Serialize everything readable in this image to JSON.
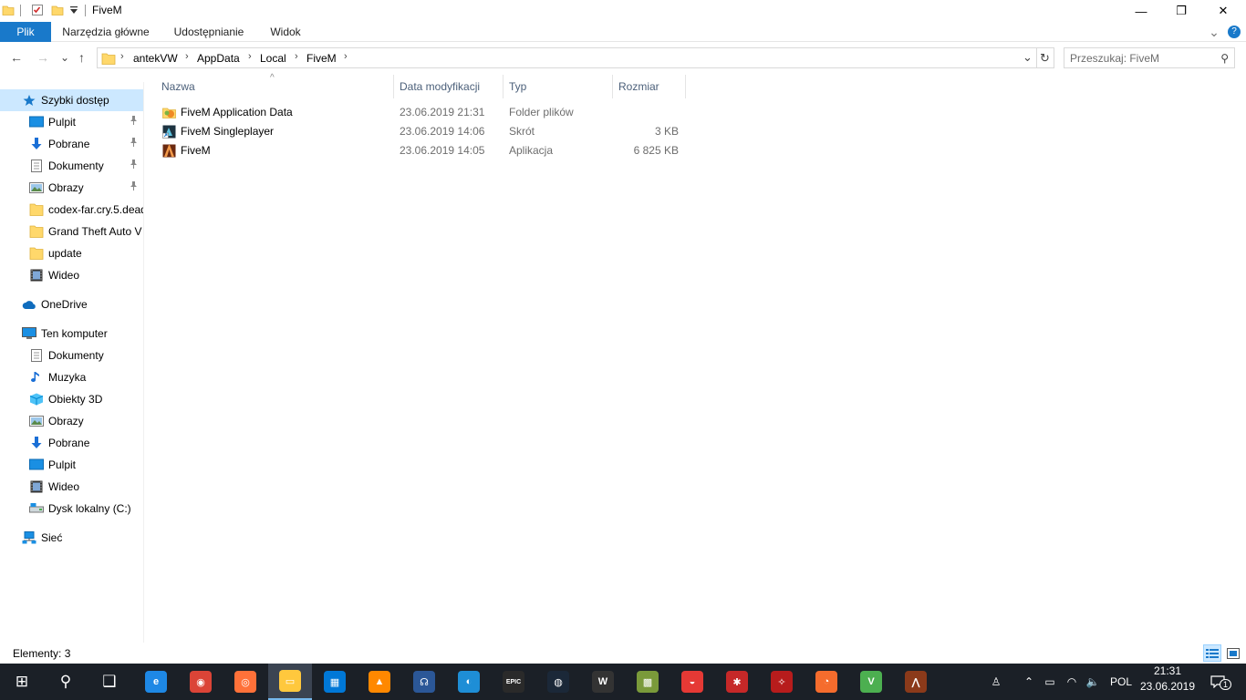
{
  "window": {
    "title": "FiveM",
    "quick_access_icons": [
      "folder-icon",
      "properties-checklist-icon",
      "new-folder-icon",
      "dropdown-arrow-icon"
    ],
    "controls": {
      "minimize": "—",
      "maximize": "❐",
      "close": "✕"
    }
  },
  "ribbon": {
    "tabs": [
      {
        "label": "Plik"
      },
      {
        "label": "Narzędzia główne"
      },
      {
        "label": "Udostępnianie"
      },
      {
        "label": "Widok"
      }
    ],
    "expand_glyph": "⌄",
    "help_glyph": "?"
  },
  "navigation": {
    "back": "←",
    "forward": "→",
    "recent": "⌄",
    "up": "↑",
    "breadcrumb": [
      "antekVW",
      "AppData",
      "Local",
      "FiveM"
    ],
    "separator": "›",
    "dropdown": "⌄",
    "refresh": "↻",
    "search_placeholder": "Przeszukaj: FiveM",
    "search_glyph": "⚲"
  },
  "sidebar": {
    "items": [
      {
        "label": "Szybki dostęp",
        "icon": "star-icon",
        "pinned": false,
        "selected": true,
        "indent": 1
      },
      {
        "label": "Pulpit",
        "icon": "desktop-icon",
        "pinned": true,
        "indent": 2
      },
      {
        "label": "Pobrane",
        "icon": "download-arrow-icon",
        "pinned": true,
        "indent": 2
      },
      {
        "label": "Dokumenty",
        "icon": "document-icon",
        "pinned": true,
        "indent": 2
      },
      {
        "label": "Obrazy",
        "icon": "pictures-icon",
        "pinned": true,
        "indent": 2
      },
      {
        "label": "codex-far.cry.5.dead",
        "icon": "folder-icon",
        "pinned": false,
        "indent": 2
      },
      {
        "label": "Grand Theft Auto V",
        "icon": "folder-icon",
        "pinned": false,
        "indent": 2
      },
      {
        "label": "update",
        "icon": "folder-icon",
        "pinned": false,
        "indent": 2
      },
      {
        "label": "Wideo",
        "icon": "video-icon",
        "pinned": false,
        "indent": 2
      },
      {
        "label": "OneDrive",
        "icon": "cloud-icon",
        "pinned": false,
        "indent": 1
      },
      {
        "label": "Ten komputer",
        "icon": "computer-icon",
        "pinned": false,
        "indent": 1
      },
      {
        "label": "Dokumenty",
        "icon": "document-icon",
        "pinned": false,
        "indent": 2
      },
      {
        "label": "Muzyka",
        "icon": "music-note-icon",
        "pinned": false,
        "indent": 2
      },
      {
        "label": "Obiekty 3D",
        "icon": "cube-3d-icon",
        "pinned": false,
        "indent": 2
      },
      {
        "label": "Obrazy",
        "icon": "pictures-icon",
        "pinned": false,
        "indent": 2
      },
      {
        "label": "Pobrane",
        "icon": "download-arrow-icon",
        "pinned": false,
        "indent": 2
      },
      {
        "label": "Pulpit",
        "icon": "desktop-icon",
        "pinned": false,
        "indent": 2
      },
      {
        "label": "Wideo",
        "icon": "video-icon",
        "pinned": false,
        "indent": 2
      },
      {
        "label": "Dysk lokalny (C:)",
        "icon": "drive-icon",
        "pinned": false,
        "indent": 2
      },
      {
        "label": "Sieć",
        "icon": "network-icon",
        "pinned": false,
        "indent": 1
      }
    ],
    "pin_glyph": "📌"
  },
  "filelist": {
    "columns": {
      "name": "Nazwa",
      "date": "Data modyfikacji",
      "type": "Typ",
      "size": "Rozmiar"
    },
    "sort_glyph": "^",
    "rows": [
      {
        "name": "FiveM Application Data",
        "date": "23.06.2019 21:31",
        "type": "Folder plików",
        "size": "",
        "icon": "fivem-folder-icon"
      },
      {
        "name": "FiveM Singleplayer",
        "date": "23.06.2019 14:06",
        "type": "Skrót",
        "size": "3 KB",
        "icon": "shortcut-icon"
      },
      {
        "name": "FiveM",
        "date": "23.06.2019 14:05",
        "type": "Aplikacja",
        "size": "6 825 KB",
        "icon": "fivem-app-icon"
      }
    ]
  },
  "statusbar": {
    "count": "Elementy: 3"
  },
  "taskbar": {
    "apps": [
      {
        "name": "start-windows-icon",
        "glyph": "⊞",
        "color": "#1b2027"
      },
      {
        "name": "search-icon",
        "glyph": "⚲",
        "color": "#1b2027"
      },
      {
        "name": "task-view-icon",
        "glyph": "❑",
        "color": "#1b2027"
      },
      {
        "name": "edge-icon",
        "glyph": "e",
        "color": "#1e88e5"
      },
      {
        "name": "chrome-icon",
        "glyph": "◉",
        "color": "#db4437"
      },
      {
        "name": "firefox-icon",
        "glyph": "◎",
        "color": "#ff7139"
      },
      {
        "name": "file-explorer-icon",
        "glyph": "▭",
        "color": "#ffc83d"
      },
      {
        "name": "store-icon",
        "glyph": "▦",
        "color": "#0078d7"
      },
      {
        "name": "vlc-icon",
        "glyph": "▲",
        "color": "#ff8800"
      },
      {
        "name": "headset-chat-icon",
        "glyph": "☊",
        "color": "#2b5797"
      },
      {
        "name": "uplay-icon",
        "glyph": "◐",
        "color": "#1e8ed6"
      },
      {
        "name": "epic-games-icon",
        "glyph": "EPIC",
        "color": "#2a2a2a"
      },
      {
        "name": "steam-icon",
        "glyph": "◍",
        "color": "#1b2838"
      },
      {
        "name": "world-of-tanks-icon",
        "glyph": "W",
        "color": "#333333"
      },
      {
        "name": "minecraft-icon",
        "glyph": "▩",
        "color": "#7a9a3a"
      },
      {
        "name": "pokeball-icon",
        "glyph": "◒",
        "color": "#e53935"
      },
      {
        "name": "mod-tool-icon",
        "glyph": "✱",
        "color": "#c62828"
      },
      {
        "name": "compass-app-icon",
        "glyph": "✧",
        "color": "#b71c1c"
      },
      {
        "name": "origin-icon",
        "glyph": "◔",
        "color": "#f56c2d"
      },
      {
        "name": "gta-v-icon",
        "glyph": "V",
        "color": "#4caf50"
      },
      {
        "name": "fivem-taskbar-icon",
        "glyph": "⋀",
        "color": "#8b3a1a"
      }
    ],
    "tray": {
      "people": "♙",
      "chevron": "⌃",
      "battery": "▭",
      "wifi": "◠",
      "volume": "🔈",
      "language": "POL",
      "time": "21:31",
      "date": "23.06.2019",
      "notifications_count": "1"
    }
  }
}
